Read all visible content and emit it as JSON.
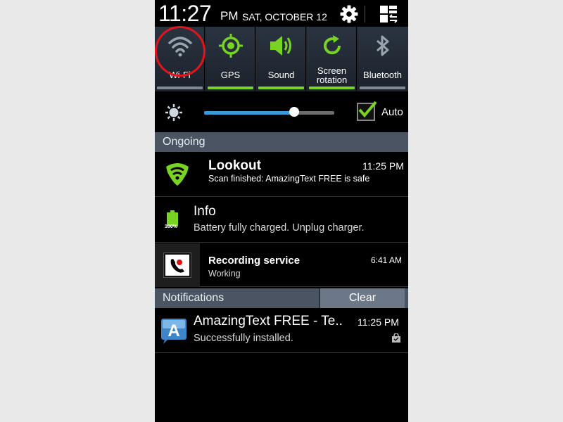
{
  "status_bar": {
    "time": "11:27",
    "ampm": "PM",
    "date": "SAT, OCTOBER 12",
    "settings_icon": "gear-icon",
    "multiwindow_icon": "grid-arrows-icon"
  },
  "quick_settings": [
    {
      "label": "Wi-Fi",
      "icon": "wifi-icon",
      "enabled": false
    },
    {
      "label": "GPS",
      "icon": "gps-icon",
      "enabled": true
    },
    {
      "label": "Sound",
      "icon": "speaker-icon",
      "enabled": true
    },
    {
      "label_line1": "Screen",
      "label_line2": "rotation",
      "icon": "rotation-icon",
      "enabled": true
    },
    {
      "label": "Bluetooth",
      "icon": "bluetooth-icon",
      "enabled": false
    }
  ],
  "brightness": {
    "icon": "brightness-icon",
    "level": 0.69,
    "auto_label": "Auto",
    "auto_checked": true
  },
  "ongoing": {
    "header": "Ongoing",
    "items": [
      {
        "app": "Lookout",
        "text": "Scan finished: AmazingText FREE is safe",
        "time": "11:25 PM",
        "icon": "lookout-shield-icon"
      },
      {
        "app": "Info",
        "text": "Battery fully charged. Unplug charger.",
        "icon": "battery-icon",
        "battery_level": "100%"
      },
      {
        "app": "Recording service",
        "text": "Working",
        "time": "6:41 AM",
        "icon": "phone-record-icon"
      }
    ]
  },
  "notifications": {
    "header": "Notifications",
    "clear_label": "Clear",
    "items": [
      {
        "app": "AmazingText FREE - Te..",
        "text": "Successfully installed.",
        "time": "11:25 PM",
        "icon": "amazingtext-icon",
        "badge_icon": "store-bag-icon"
      }
    ]
  },
  "colors": {
    "accent_green": "#78d323",
    "slider_blue": "#3a9ad9",
    "annotation_red": "#e4141c",
    "section_header": "#4a5463"
  }
}
